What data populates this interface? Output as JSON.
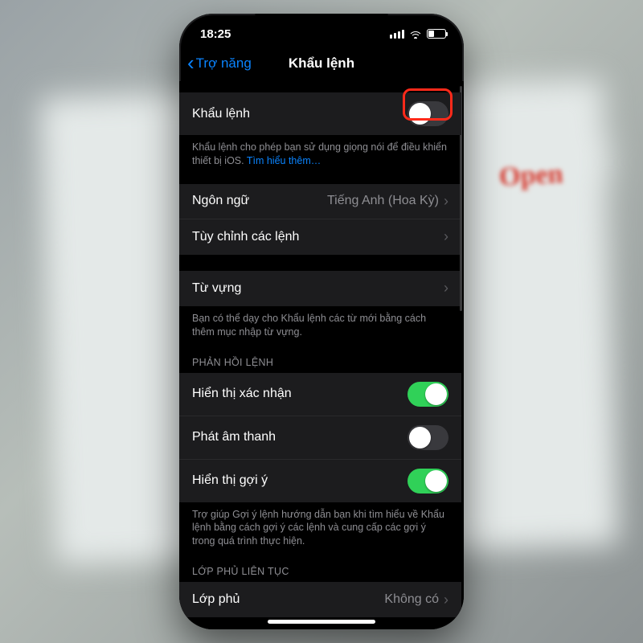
{
  "status": {
    "time": "18:25"
  },
  "nav": {
    "back": "Trợ năng",
    "title": "Khẩu lệnh"
  },
  "main_toggle": {
    "label": "Khẩu lệnh"
  },
  "main_footer": {
    "text": "Khẩu lệnh cho phép bạn sử dụng giọng nói để điều khiển thiết bị iOS. ",
    "link": "Tìm hiểu thêm…"
  },
  "language_row": {
    "label": "Ngôn ngữ",
    "value": "Tiếng Anh (Hoa Kỳ)"
  },
  "customize_row": {
    "label": "Tùy chỉnh các lệnh"
  },
  "vocab_row": {
    "label": "Từ vựng"
  },
  "vocab_footer": "Bạn có thể dạy cho Khẩu lệnh các từ mới bằng cách thêm mục nhập từ vựng.",
  "section_feedback": "PHẢN HỒI LỆNH",
  "feedback": {
    "confirm": "Hiển thị xác nhận",
    "sound": "Phát âm thanh",
    "hint": "Hiển thị gợi ý"
  },
  "feedback_footer": "Trợ giúp Gợi ý lệnh hướng dẫn bạn khi tìm hiểu về Khẩu lệnh bằng cách gợi ý các lệnh và cung cấp các gợi ý trong quá trình thực hiện.",
  "section_overlay": "LỚP PHỦ LIÊN TỤC",
  "overlay_row": {
    "label": "Lớp phủ",
    "value": "Không có"
  }
}
